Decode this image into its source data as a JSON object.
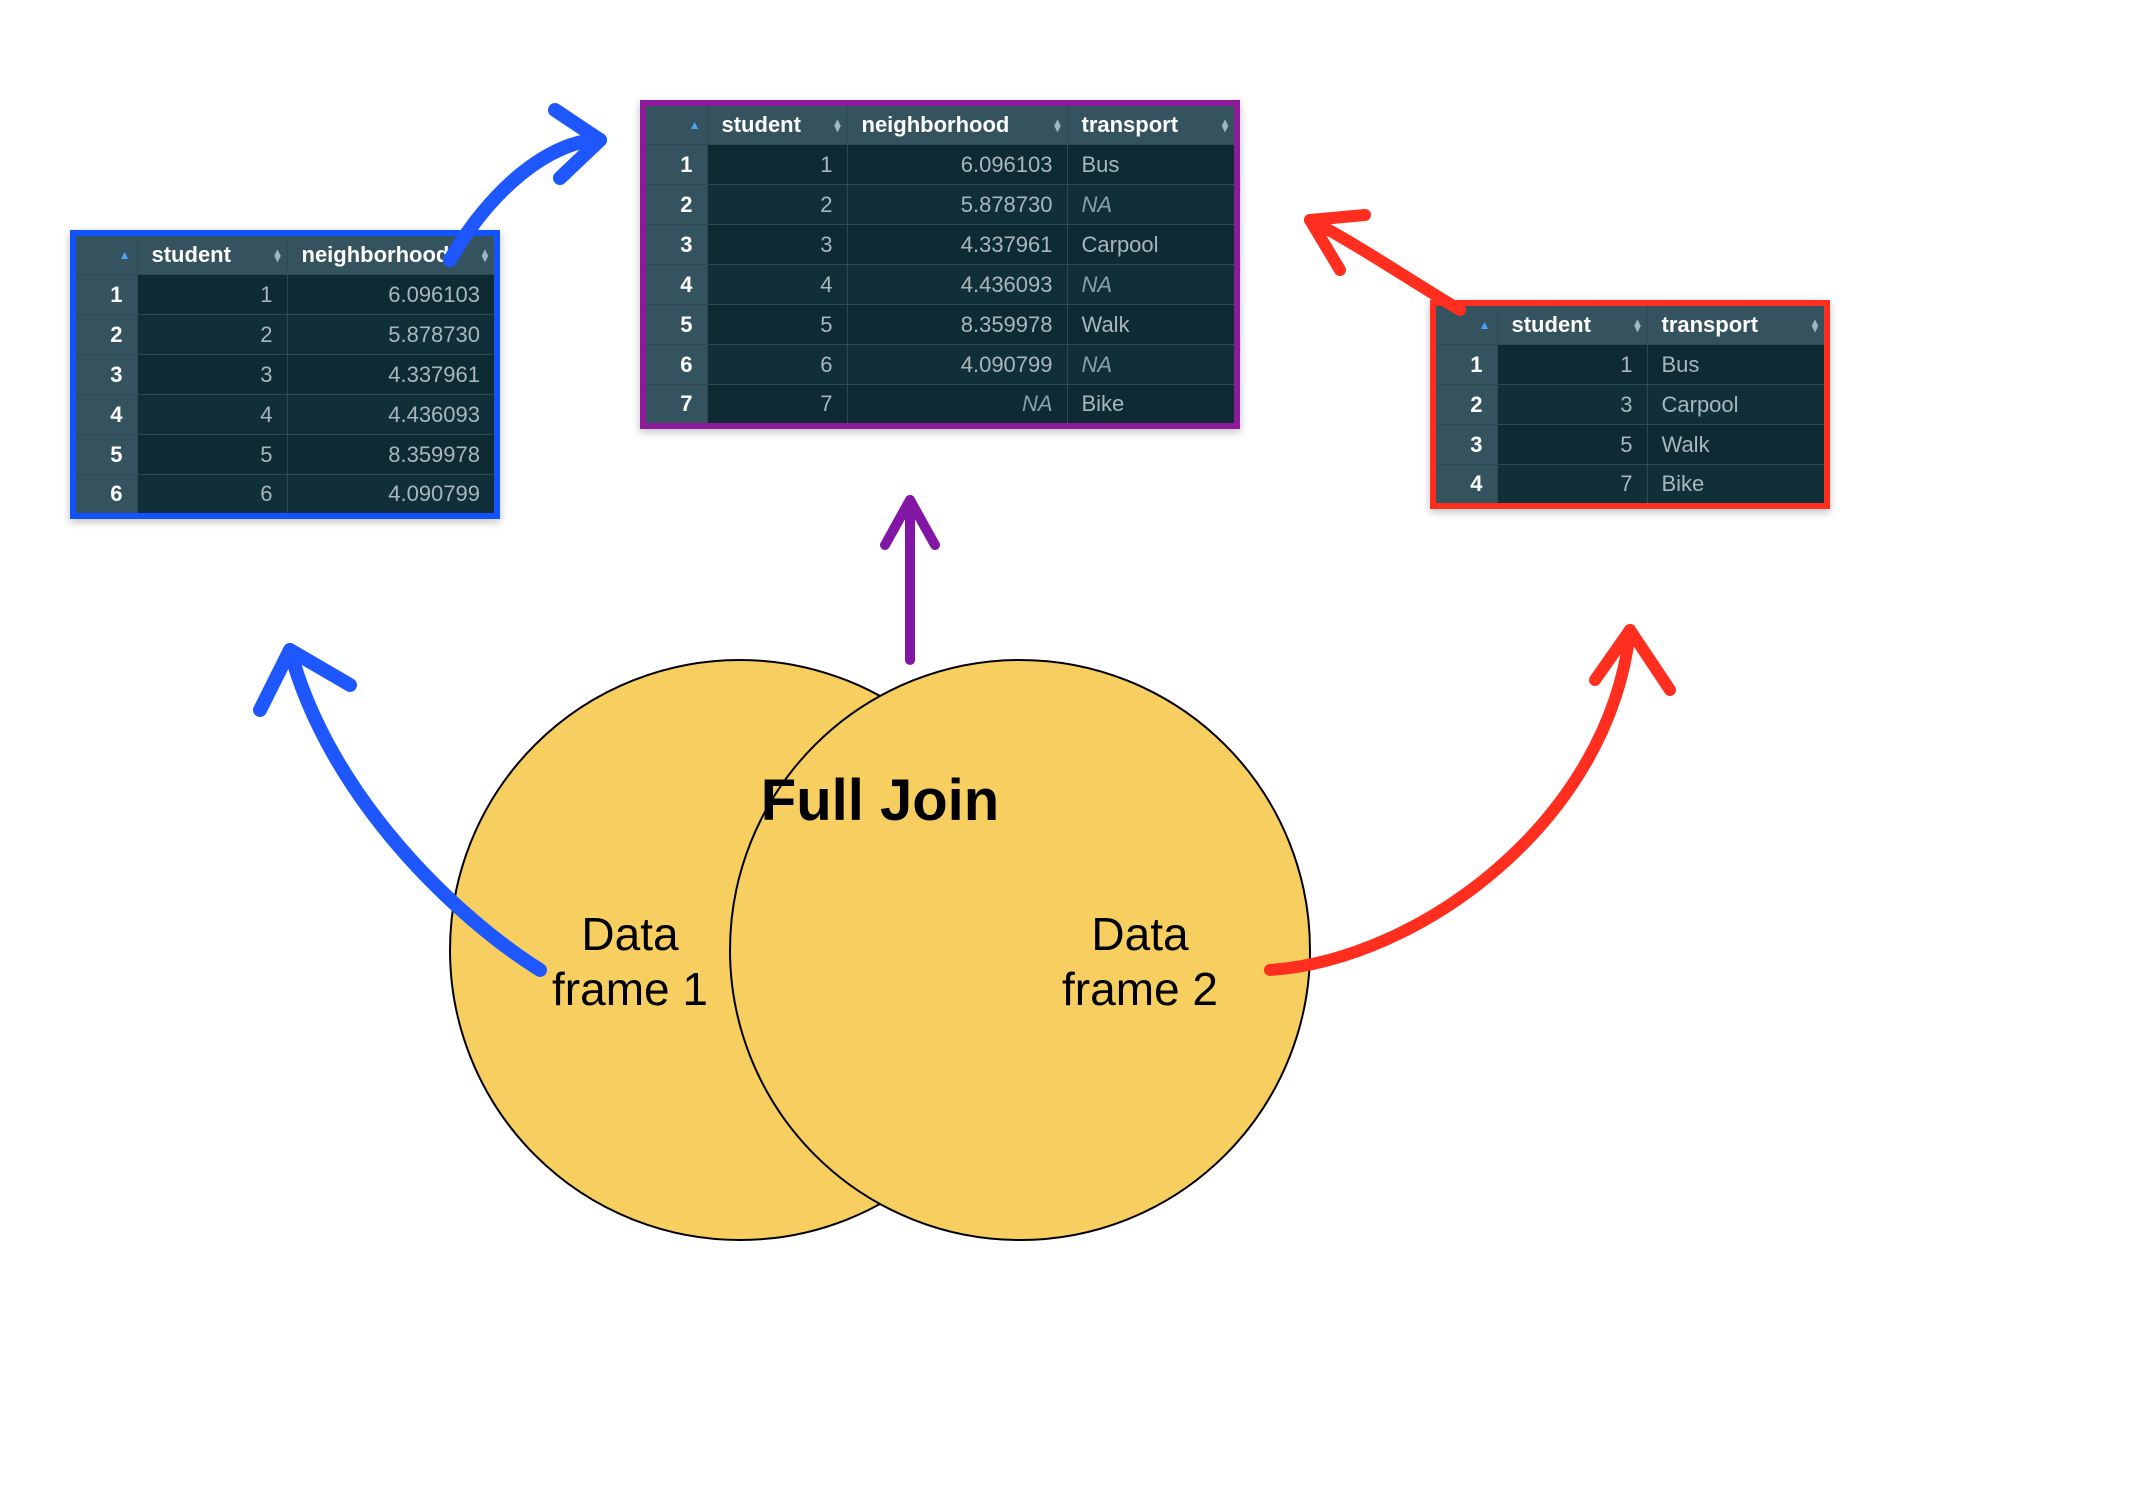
{
  "title": "Full Join",
  "venn": {
    "left_label_l1": "Data",
    "left_label_l2": "frame 1",
    "right_label_l1": "Data",
    "right_label_l2": "frame 2"
  },
  "colors": {
    "blue": "#1154ff",
    "purple": "#8d1a9b",
    "red": "#ff2e1f",
    "arrow_blue": "#1f57ff",
    "arrow_purple": "#8217a6",
    "arrow_red": "#ff2e1f",
    "venn_fill": "#f7cf60"
  },
  "df1": {
    "columns": [
      "student",
      "neighborhood"
    ],
    "rows": [
      {
        "rn": "1",
        "student": "1",
        "neighborhood": "6.096103"
      },
      {
        "rn": "2",
        "student": "2",
        "neighborhood": "5.878730"
      },
      {
        "rn": "3",
        "student": "3",
        "neighborhood": "4.337961"
      },
      {
        "rn": "4",
        "student": "4",
        "neighborhood": "4.436093"
      },
      {
        "rn": "5",
        "student": "5",
        "neighborhood": "8.359978"
      },
      {
        "rn": "6",
        "student": "6",
        "neighborhood": "4.090799"
      }
    ]
  },
  "df_join": {
    "columns": [
      "student",
      "neighborhood",
      "transport"
    ],
    "rows": [
      {
        "rn": "1",
        "student": "1",
        "neighborhood": "6.096103",
        "transport": "Bus"
      },
      {
        "rn": "2",
        "student": "2",
        "neighborhood": "5.878730",
        "transport": "NA"
      },
      {
        "rn": "3",
        "student": "3",
        "neighborhood": "4.337961",
        "transport": "Carpool"
      },
      {
        "rn": "4",
        "student": "4",
        "neighborhood": "4.436093",
        "transport": "NA"
      },
      {
        "rn": "5",
        "student": "5",
        "neighborhood": "8.359978",
        "transport": "Walk"
      },
      {
        "rn": "6",
        "student": "6",
        "neighborhood": "4.090799",
        "transport": "NA"
      },
      {
        "rn": "7",
        "student": "7",
        "neighborhood": "NA",
        "transport": "Bike"
      }
    ]
  },
  "df2": {
    "columns": [
      "student",
      "transport"
    ],
    "rows": [
      {
        "rn": "1",
        "student": "1",
        "transport": "Bus"
      },
      {
        "rn": "2",
        "student": "3",
        "transport": "Carpool"
      },
      {
        "rn": "3",
        "student": "5",
        "transport": "Walk"
      },
      {
        "rn": "4",
        "student": "7",
        "transport": "Bike"
      }
    ]
  },
  "chart_data": {
    "type": "table",
    "description": "Venn diagram illustrating a SQL/R full join of two data frames on the 'student' key.",
    "join_type": "full",
    "key": "student",
    "left": {
      "name": "Data frame 1",
      "columns": [
        "student",
        "neighborhood"
      ],
      "rows": [
        [
          1,
          6.096103
        ],
        [
          2,
          5.87873
        ],
        [
          3,
          4.337961
        ],
        [
          4,
          4.436093
        ],
        [
          5,
          8.359978
        ],
        [
          6,
          4.090799
        ]
      ]
    },
    "right": {
      "name": "Data frame 2",
      "columns": [
        "student",
        "transport"
      ],
      "rows": [
        [
          1,
          "Bus"
        ],
        [
          3,
          "Carpool"
        ],
        [
          5,
          "Walk"
        ],
        [
          7,
          "Bike"
        ]
      ]
    },
    "result": {
      "columns": [
        "student",
        "neighborhood",
        "transport"
      ],
      "rows": [
        [
          1,
          6.096103,
          "Bus"
        ],
        [
          2,
          5.87873,
          null
        ],
        [
          3,
          4.337961,
          "Carpool"
        ],
        [
          4,
          4.436093,
          null
        ],
        [
          5,
          8.359978,
          "Walk"
        ],
        [
          6,
          4.090799,
          null
        ],
        [
          7,
          null,
          "Bike"
        ]
      ]
    }
  }
}
